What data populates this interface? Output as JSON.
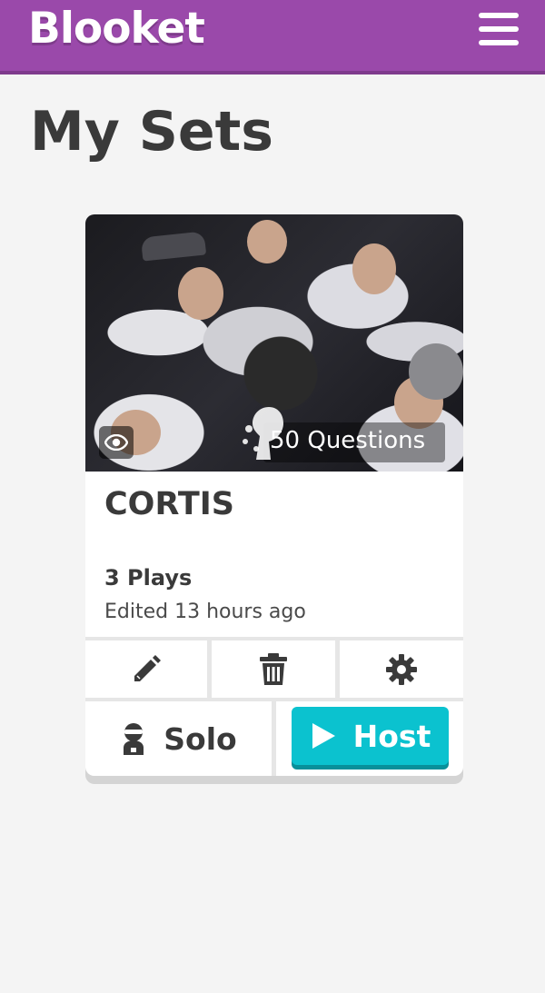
{
  "header": {
    "logo": "Blooket",
    "menu_icon": "hamburger-menu-icon",
    "background": "#9a49aa"
  },
  "page": {
    "title": "My Sets"
  },
  "set_card": {
    "title": "CORTIS",
    "question_count": "50 Questions",
    "plays": "3 Plays",
    "edited": "Edited 13 hours ago",
    "actions": {
      "edit_icon": "pencil-icon",
      "delete_icon": "trash-icon",
      "settings_icon": "gear-icon"
    },
    "solo_label": "Solo",
    "host_label": "Host",
    "host_color": "#0bc2cf"
  }
}
